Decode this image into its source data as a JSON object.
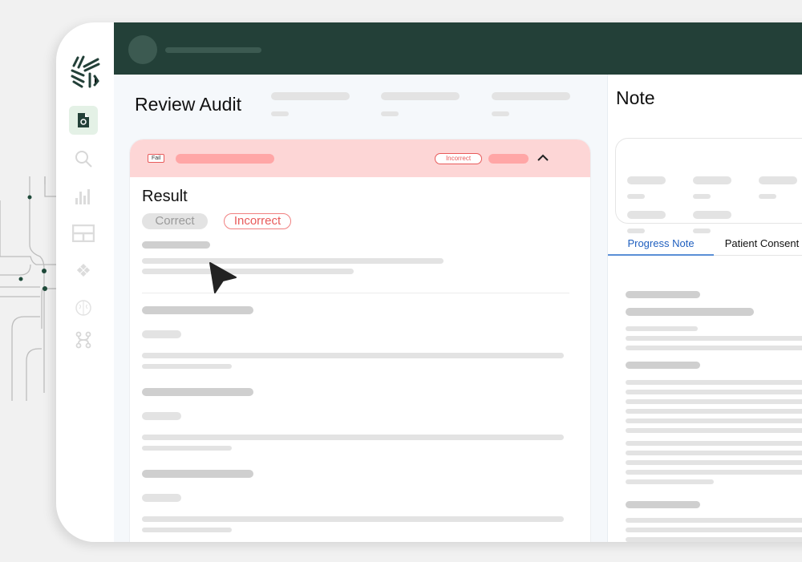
{
  "colors": {
    "header": "#234038",
    "accent": "#1f5fbf",
    "fail_bg": "#fdd6d6",
    "incorrect": "#e85a5a",
    "active_nav_bg": "#e4f1e6"
  },
  "sidebar": {
    "items": [
      {
        "icon": "document-search-icon",
        "active": true
      },
      {
        "icon": "search-icon"
      },
      {
        "icon": "bar-chart-icon"
      },
      {
        "icon": "table-icon"
      },
      {
        "icon": "puzzle-icon"
      },
      {
        "icon": "brain-icon"
      },
      {
        "icon": "workflow-icon"
      }
    ]
  },
  "main": {
    "title": "Review Audit",
    "card": {
      "status_tag": "Fail",
      "header_badge": "Incorrect",
      "section_title": "Result",
      "options": [
        "Correct",
        "Incorrect"
      ],
      "selected": "Incorrect"
    }
  },
  "note": {
    "title": "Note",
    "tabs": [
      {
        "label": "Progress Note",
        "active": true
      },
      {
        "label": "Patient Consent"
      }
    ]
  }
}
